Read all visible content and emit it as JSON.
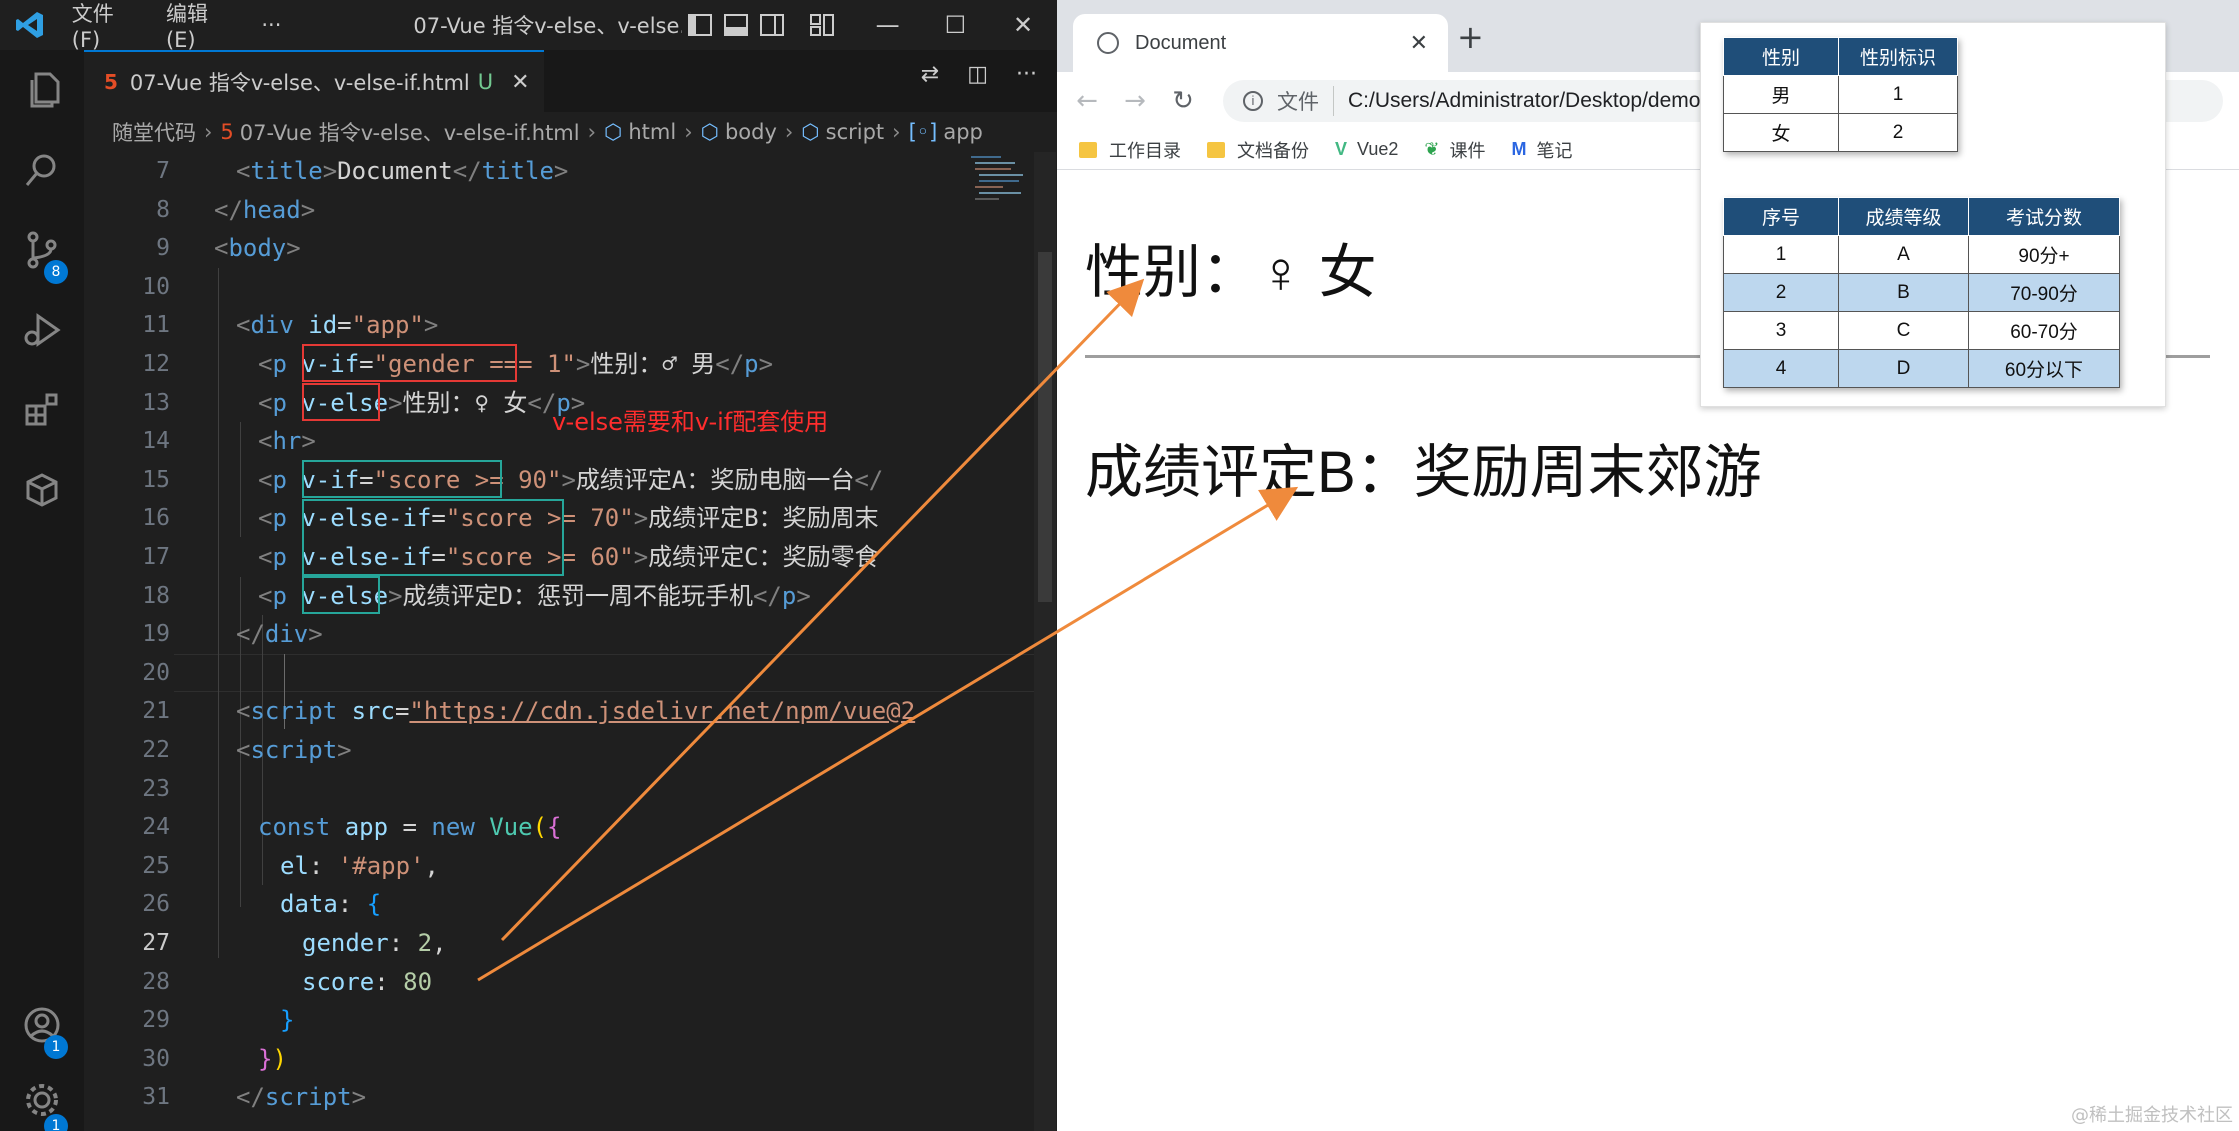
{
  "titlebar": {
    "menu": [
      "文件(F)",
      "编辑(E)",
      "···"
    ],
    "window_title": "07-Vue 指令v-else、v-else..."
  },
  "activity": {
    "scm_badge": "8",
    "account_badge": "1",
    "settings_badge": "1"
  },
  "tab": {
    "label": "07-Vue 指令v-else、v-else-if.html",
    "modified": "U",
    "close": "✕"
  },
  "breadcrumb": [
    "随堂代码",
    "07-Vue 指令v-else、v-else-if.html",
    "html",
    "body",
    "script",
    "app"
  ],
  "editor": {
    "line_numbers": [
      "7",
      "8",
      "9",
      "10",
      "11",
      "12",
      "13",
      "14",
      "15",
      "16",
      "17",
      "18",
      "19",
      "20",
      "21",
      "22",
      "23",
      "24",
      "25",
      "26",
      "27",
      "28",
      "29",
      "30",
      "31"
    ],
    "active_line": "27",
    "note": "v-else需要和v-if配套使用",
    "lines": {
      "l7": {
        "indent": "  ",
        "t1": "<",
        "tag": "title",
        "t2": ">",
        "text": "Document",
        "t3": "</",
        "tag2": "title",
        "t4": ">"
      },
      "l8": {
        "t1": "</",
        "tag": "head",
        "t2": ">"
      },
      "l9": {
        "t1": "<",
        "tag": "body",
        "t2": ">"
      },
      "l11": {
        "t1": "<",
        "tag": "div",
        "attr": "id",
        "eq": "=",
        "val": "\"app\"",
        "t2": ">"
      },
      "l12": {
        "t1": "<",
        "tag": "p",
        "attr": "v-if",
        "eq": "=",
        "val": "\"gender === 1\"",
        "t2": ">",
        "text": "性别：♂ 男",
        "t3": "</",
        "tag2": "p",
        "t4": ">"
      },
      "l13": {
        "t1": "<",
        "tag": "p",
        "attr": "v-else",
        "t2": ">",
        "text": "性别：♀ 女",
        "t3": "</",
        "tag2": "p",
        "t4": ">"
      },
      "l14": {
        "t1": "<",
        "tag": "hr",
        "t2": ">"
      },
      "l15": {
        "t1": "<",
        "tag": "p",
        "attr": "v-if",
        "eq": "=",
        "val": "\"score >= 90\"",
        "t2": ">",
        "text": "成绩评定A：奖励电脑一台",
        "t3": "</"
      },
      "l16": {
        "t1": "<",
        "tag": "p",
        "attr": "v-else-if",
        "eq": "=",
        "val": "\"score >= 70\"",
        "t2": ">",
        "text": "成绩评定B：奖励周末"
      },
      "l17": {
        "t1": "<",
        "tag": "p",
        "attr": "v-else-if",
        "eq": "=",
        "val": "\"score >= 60\"",
        "t2": ">",
        "text": "成绩评定C：奖励零食"
      },
      "l18": {
        "t1": "<",
        "tag": "p",
        "attr": "v-else",
        "t2": ">",
        "text": "成绩评定D：惩罚一周不能玩手机",
        "t3": "</",
        "tag2": "p",
        "t4": ">"
      },
      "l19": {
        "t1": "</",
        "tag": "div",
        "t2": ">"
      },
      "l21": {
        "t1": "<",
        "tag": "script",
        "attr": "src",
        "eq": "=",
        "val": "\"https://cdn.jsdelivr.net/npm/vue@2"
      },
      "l22": {
        "t1": "<",
        "tag": "script",
        "t2": ">"
      },
      "l24": {
        "kw": "const",
        "var": "app",
        "op": "=",
        "kw2": "new",
        "cls": "Vue",
        "p": "(",
        "b": "{"
      },
      "l25": {
        "key": "el",
        "colon": ":",
        "str": "'#app'",
        "comma": ","
      },
      "l26": {
        "key": "data",
        "colon": ":",
        "b": "{"
      },
      "l27": {
        "key": "gender",
        "colon": ":",
        "num": "2",
        "comma": ","
      },
      "l28": {
        "key": "score",
        "colon": ":",
        "num": "80"
      },
      "l29": {
        "b": "}"
      },
      "l30": {
        "b": "}",
        "p": ")"
      },
      "l31": {
        "t1": "</",
        "tag": "script",
        "t2": ">"
      }
    }
  },
  "browser": {
    "tab_title": "Document",
    "new_tab": "+",
    "scheme": "文件",
    "url": "C:/Users/Administrator/Desktop/demo",
    "bookmarks": [
      "工作目录",
      "文档备份",
      "Vue2",
      "课件",
      "笔记"
    ],
    "page": {
      "gender_line": "性别：♀ 女",
      "score_line": "成绩评定B：奖励周末郊游"
    }
  },
  "overlay": {
    "gender_table": {
      "headers": [
        "性别",
        "性别标识"
      ],
      "rows": [
        [
          "男",
          "1"
        ],
        [
          "女",
          "2"
        ]
      ]
    },
    "score_table": {
      "headers": [
        "序号",
        "成绩等级",
        "考试分数"
      ],
      "rows": [
        [
          "1",
          "A",
          "90分+"
        ],
        [
          "2",
          "B",
          "70-90分"
        ],
        [
          "3",
          "C",
          "60-70分"
        ],
        [
          "4",
          "D",
          "60分以下"
        ]
      ]
    }
  },
  "watermark": "@稀土掘金技术社区",
  "colors": {
    "accent": "#0078d4",
    "annotation_red": "#e53935",
    "annotation_teal": "#26a69a",
    "arrow": "#ef8a3c",
    "table_header": "#1f4e79",
    "table_alt_row": "#bdd7ee"
  }
}
